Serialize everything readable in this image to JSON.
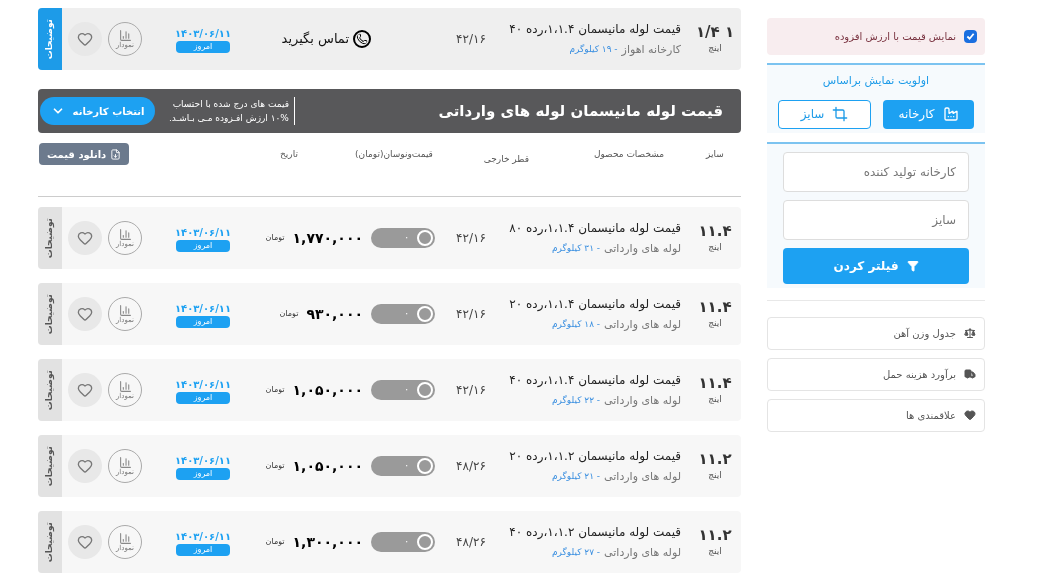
{
  "featured_row": {
    "size": "۱ ۱/۴",
    "unit": "اینچ",
    "title": "قیمت لوله مانیسمان ۱،۱.۴،رده ۴۰",
    "source": "کارخانه اهواز",
    "weight": "- ۱۹ کیلوگرم",
    "diameter": "۴۲/۱۶",
    "contact": "تماس بگیرید",
    "date": "۱۴۰۳/۰۶/۱۱",
    "date_badge": "امروز",
    "chart_label": "نمودار",
    "favorite": false,
    "description_tab": "توضیحات",
    "highlighted": true
  },
  "section": {
    "title": "قیمت لوله مانیسمان لوله های وارداتی",
    "notice": [
      "قیمت های درج شده با احتساب",
      "۱۰% ارزش افـزوده مـی بـاشـد."
    ],
    "factory_button": "انتخاب کارخانه"
  },
  "table": {
    "columns": [
      "سایز",
      "مشخصات محصول",
      "قطر خارجی",
      "قیمت‌ونوسان(تومان)",
      "تاریخ"
    ],
    "download_button": "دانلود قیمت",
    "rows": [
      {
        "size": "۱۱.۴",
        "unit": "اینچ",
        "title": "قیمت لوله مانیسمان ۱،۱.۴،رده ۸۰",
        "source": "لوله های وارداتی",
        "weight": "- ۳۱ کیلوگرم",
        "diameter": "۴۲/۱۶",
        "toggle_label": "۰",
        "toggle_on": false,
        "price": "۱,۷۷۰,۰۰۰",
        "currency": "تومان",
        "date": "۱۴۰۳/۰۶/۱۱",
        "date_badge": "امروز",
        "chart_label": "نمودار",
        "favorite": false,
        "description_tab": "توضیحات",
        "highlighted": false
      },
      {
        "size": "۱۱.۴",
        "unit": "اینچ",
        "title": "قیمت لوله مانیسمان ۱،۱.۴،رده ۲۰",
        "source": "لوله های وارداتی",
        "weight": "- ۱۸ کیلوگرم",
        "diameter": "۴۲/۱۶",
        "toggle_label": "۰",
        "toggle_on": false,
        "price": "۹۳۰,۰۰۰",
        "currency": "تومان",
        "date": "۱۴۰۳/۰۶/۱۱",
        "date_badge": "امروز",
        "chart_label": "نمودار",
        "favorite": false,
        "description_tab": "توضیحات",
        "highlighted": false
      },
      {
        "size": "۱۱.۴",
        "unit": "اینچ",
        "title": "قیمت لوله مانیسمان ۱،۱.۴،رده ۴۰",
        "source": "لوله های وارداتی",
        "weight": "- ۲۲ کیلوگرم",
        "diameter": "۴۲/۱۶",
        "toggle_label": "۰",
        "toggle_on": false,
        "price": "۱,۰۵۰,۰۰۰",
        "currency": "تومان",
        "date": "۱۴۰۳/۰۶/۱۱",
        "date_badge": "امروز",
        "chart_label": "نمودار",
        "favorite": false,
        "description_tab": "توضیحات",
        "highlighted": false
      },
      {
        "size": "۱۱.۲",
        "unit": "اینچ",
        "title": "قیمت لوله مانیسمان ۱،۱.۲،رده ۲۰",
        "source": "لوله های وارداتی",
        "weight": "- ۲۱ کیلوگرم",
        "diameter": "۴۸/۲۶",
        "toggle_label": "۰",
        "toggle_on": false,
        "price": "۱,۰۵۰,۰۰۰",
        "currency": "تومان",
        "date": "۱۴۰۳/۰۶/۱۱",
        "date_badge": "امروز",
        "chart_label": "نمودار",
        "favorite": false,
        "description_tab": "توضیحات",
        "highlighted": false
      },
      {
        "size": "۱۱.۲",
        "unit": "اینچ",
        "title": "قیمت لوله مانیسمان ۱،۱.۲،رده ۴۰",
        "source": "لوله های وارداتی",
        "weight": "- ۲۷ کیلوگرم",
        "diameter": "۴۸/۲۶",
        "toggle_label": "۰",
        "toggle_on": false,
        "price": "۱,۳۰۰,۰۰۰",
        "currency": "تومان",
        "date": "۱۴۰۳/۰۶/۱۱",
        "date_badge": "امروز",
        "chart_label": "نمودار",
        "favorite": false,
        "description_tab": "توضیحات",
        "highlighted": false
      }
    ]
  },
  "sidebar": {
    "vat_checkbox": {
      "label": "نمایش قیمت با ارزش افزوده",
      "checked": true
    },
    "priority": {
      "title": "اولویت نمایش براساس",
      "options": [
        {
          "label": "کارخانه",
          "kind": "factory",
          "selected": true
        },
        {
          "label": "سایز",
          "kind": "crop",
          "selected": false
        }
      ]
    },
    "filter": {
      "fields": [
        {
          "placeholder": "کارخانه تولید کننده"
        },
        {
          "placeholder": "سایز"
        }
      ],
      "button": "فیلتر کردن"
    },
    "links": [
      {
        "label": "جدول وزن آهن",
        "kind": "scale"
      },
      {
        "label": "برآورد هزینه حمل",
        "kind": "truck"
      },
      {
        "label": "علاقمندی ها",
        "kind": "heart"
      }
    ]
  }
}
